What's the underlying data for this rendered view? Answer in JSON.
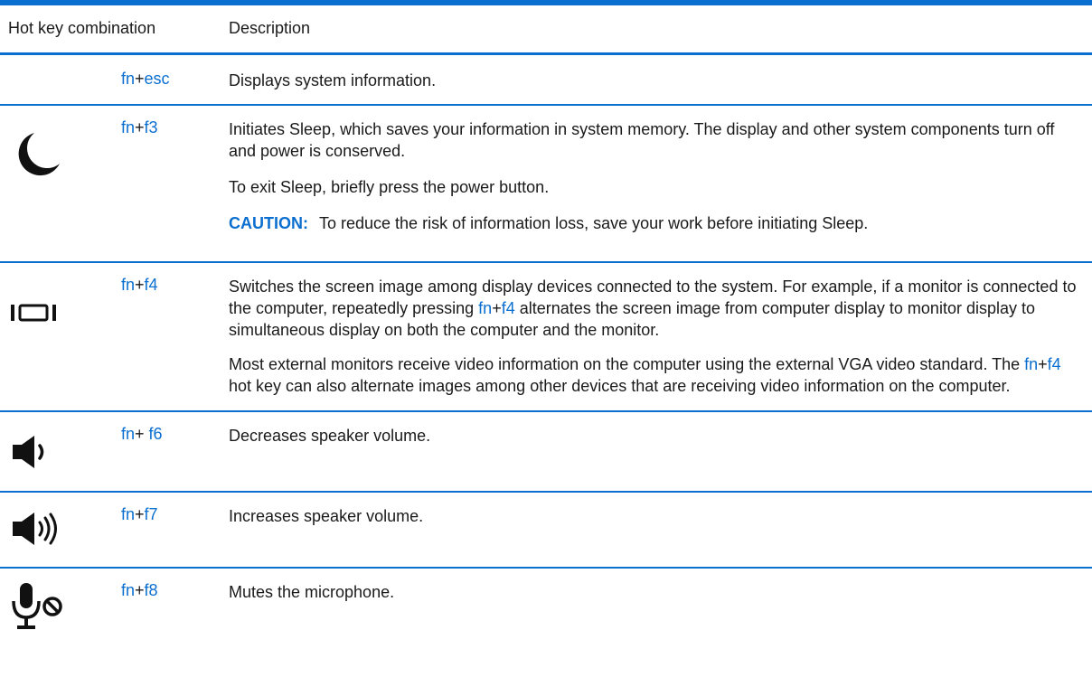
{
  "header": {
    "key_col": "Hot key combination",
    "desc_col": "Description"
  },
  "rows": [
    {
      "fn": "fn",
      "plus": "+",
      "key": "esc",
      "icon": "none",
      "desc": [
        "Displays system information."
      ]
    },
    {
      "fn": "fn",
      "plus": "+",
      "key": "f3",
      "icon": "crescent-moon-icon",
      "desc": [
        "Initiates Sleep, which saves your information in system memory. The display and other system components turn off and power is conserved.",
        "To exit Sleep, briefly press the power button."
      ],
      "caution_label": "CAUTION:",
      "caution_text": "To reduce the risk of information loss, save your work before initiating Sleep."
    },
    {
      "fn": "fn",
      "plus": "+",
      "key": "f4",
      "icon": "display-switch-icon",
      "desc_p1_a": "Switches the screen image among display devices connected to the system. For example, if a monitor is connected to the computer, repeatedly pressing ",
      "desc_p1_fn": "fn",
      "desc_p1_plus": "+",
      "desc_p1_key": "f4",
      "desc_p1_b": " alternates the screen image from computer display to monitor display to simultaneous display on both the computer and the monitor.",
      "desc_p2_a": "Most external monitors receive video information on the computer using the external VGA video standard. The ",
      "desc_p2_fn": "fn",
      "desc_p2_plus": "+",
      "desc_p2_key": "f4",
      "desc_p2_b": " hot key can also alternate images among other devices that are receiving video information on the computer."
    },
    {
      "fn": "fn",
      "plus": "+ ",
      "key": "f6",
      "icon": "volume-down-icon",
      "desc": [
        "Decreases speaker volume."
      ]
    },
    {
      "fn": "fn",
      "plus": "+",
      "key": "f7",
      "icon": "volume-up-icon",
      "desc": [
        "Increases speaker volume."
      ]
    },
    {
      "fn": "fn",
      "plus": "+",
      "key": "f8",
      "icon": "microphone-mute-icon",
      "desc": [
        "Mutes the microphone."
      ]
    }
  ],
  "colors": {
    "accent": "#0b6fd0",
    "text": "#1a1a1a"
  }
}
